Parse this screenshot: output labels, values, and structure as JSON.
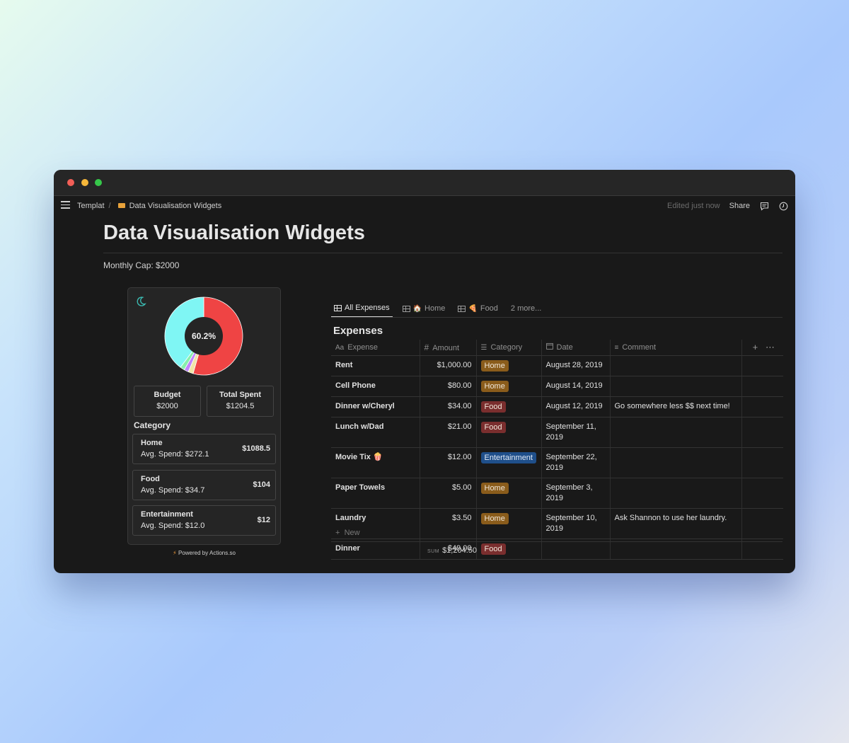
{
  "breadcrumb": {
    "parent": "Templat",
    "current": "Data Visualisation Widgets"
  },
  "topbar": {
    "edited": "Edited just now",
    "share": "Share"
  },
  "page": {
    "title": "Data Visualisation Widgets",
    "monthly_cap": "Monthly Cap: $2000"
  },
  "widget": {
    "percent": "60.2%",
    "budget_label": "Budget",
    "budget_value": "$2000",
    "spent_label": "Total Spent",
    "spent_value": "$1204.5",
    "category_heading": "Category",
    "categories": [
      {
        "name": "Home",
        "avg": "Avg. Spend: $272.1",
        "total": "$1088.5"
      },
      {
        "name": "Food",
        "avg": "Avg. Spend: $34.7",
        "total": "$104"
      },
      {
        "name": "Entertainment",
        "avg": "Avg. Spend: $12.0",
        "total": "$12"
      }
    ],
    "powered": "Powered by Actions.so"
  },
  "chart_data": {
    "type": "pie",
    "labels": [],
    "slices": [
      {
        "value": 1088.5,
        "color": "#ef4444"
      },
      {
        "value": 42,
        "color": "#f0e6a8"
      },
      {
        "value": 37,
        "color": "#c084fc"
      },
      {
        "value": 37,
        "color": "#86efac"
      },
      {
        "value": 795.5,
        "color": "#7ff6f4"
      }
    ],
    "center_label": "60.2%"
  },
  "tabs": [
    {
      "label": "All Expenses",
      "emoji": ""
    },
    {
      "label": "Home",
      "emoji": "🏠"
    },
    {
      "label": "Food",
      "emoji": "🍕"
    },
    {
      "label": "2 more...",
      "emoji": ""
    }
  ],
  "database": {
    "title": "Expenses",
    "columns": {
      "expense": "Expense",
      "amount": "Amount",
      "category": "Category",
      "date": "Date",
      "comment": "Comment"
    },
    "rows": [
      {
        "expense": "Rent",
        "amount": "$1,000.00",
        "category": "Home",
        "date": "August 28, 2019",
        "comment": ""
      },
      {
        "expense": "Cell Phone",
        "amount": "$80.00",
        "category": "Home",
        "date": "August 14, 2019",
        "comment": ""
      },
      {
        "expense": "Dinner w/Cheryl",
        "amount": "$34.00",
        "category": "Food",
        "date": "August 12, 2019",
        "comment": "Go somewhere less $$ next time!"
      },
      {
        "expense": "Lunch w/Dad",
        "amount": "$21.00",
        "category": "Food",
        "date": "September 11, 2019",
        "comment": ""
      },
      {
        "expense": "Movie Tix 🍿",
        "amount": "$12.00",
        "category": "Entertainment",
        "date": "September 22, 2019",
        "comment": ""
      },
      {
        "expense": "Paper Towels",
        "amount": "$5.00",
        "category": "Home",
        "date": "September 3, 2019",
        "comment": ""
      },
      {
        "expense": "Laundry",
        "amount": "$3.50",
        "category": "Home",
        "date": "September 10, 2019",
        "comment": "Ask Shannon to use her laundry."
      },
      {
        "expense": "Dinner",
        "amount": "$49.00",
        "category": "Food",
        "date": "",
        "comment": ""
      }
    ],
    "new_label": "New",
    "sum_label": "SUM",
    "sum_value": "$1,204.50"
  }
}
